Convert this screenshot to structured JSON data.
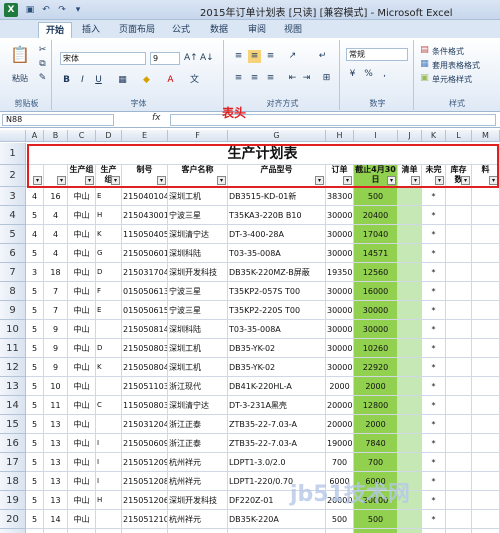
{
  "window": {
    "title": "2015年订单计划表 [只读] [兼容模式] - Microsoft Excel",
    "logo": "X"
  },
  "quick_access": [
    "save-icon",
    "undo-icon",
    "redo-icon",
    "dropdown-icon"
  ],
  "tabs": [
    "开始",
    "插入",
    "页面布局",
    "公式",
    "数据",
    "审阅",
    "视图"
  ],
  "ribbon": {
    "clipboard": {
      "paste": "粘贴",
      "label": "剪贴板"
    },
    "font": {
      "name": "宋体",
      "size": "9",
      "bold": "B",
      "italic": "I",
      "underline": "U",
      "label": "字体"
    },
    "align": {
      "label": "对齐方式"
    },
    "number": {
      "format": "常规",
      "percent": "%",
      "comma": ",",
      "label": "数字"
    },
    "styles": {
      "conditional": "条件格式",
      "table": "套用表格格式",
      "cell": "单元格样式",
      "label": "样式"
    }
  },
  "formula_bar": {
    "name_box": "N88",
    "fx": "fx",
    "value": ""
  },
  "columns": [
    "A",
    "B",
    "C",
    "D",
    "E",
    "F",
    "G",
    "H",
    "I",
    "J",
    "K",
    "L",
    "M"
  ],
  "sheet": {
    "title": "生产计划表",
    "header": [
      "",
      "",
      "生产组",
      "生产组",
      "制号",
      "客户名称",
      "产品型号",
      "订单",
      "截止4月30日",
      "清单",
      "未完",
      "库存数",
      "料"
    ],
    "rows": [
      {
        "n": "3",
        "a": "4",
        "b": "16",
        "c": "中山",
        "d": "E",
        "e": "215040104",
        "f": "深圳工机",
        "g": "DB3515-KD-01新",
        "h": "38300",
        "i": "500",
        "k": "*"
      },
      {
        "n": "4",
        "a": "5",
        "b": "4",
        "c": "中山",
        "d": "H",
        "e": "215043001",
        "f": "宁波三星",
        "g": "T35KA3-220B B10",
        "h": "30000",
        "i": "20400",
        "k": "*"
      },
      {
        "n": "5",
        "a": "4",
        "b": "4",
        "c": "中山",
        "d": "K",
        "e": "115050405",
        "f": "深圳清宁达",
        "g": "DT-3-400-28A",
        "h": "30000",
        "i": "17040",
        "k": "*"
      },
      {
        "n": "6",
        "a": "5",
        "b": "4",
        "c": "中山",
        "d": "G",
        "e": "215050601",
        "f": "深圳科陆",
        "g": "T03-35-008A",
        "h": "30000",
        "i": "14571",
        "k": "*"
      },
      {
        "n": "7",
        "a": "3",
        "b": "18",
        "c": "中山",
        "d": "D",
        "e": "215031704",
        "f": "深圳开发科技",
        "g": "DB35K-220MZ-B屏蔽",
        "h": "19350",
        "i": "12560",
        "k": "*"
      },
      {
        "n": "8",
        "a": "5",
        "b": "7",
        "c": "中山",
        "d": "F",
        "e": "015050613",
        "f": "宁波三星",
        "g": "T35KP2-057S T00",
        "h": "30000",
        "i": "16000",
        "k": "*"
      },
      {
        "n": "9",
        "a": "5",
        "b": "7",
        "c": "中山",
        "d": "E",
        "e": "015050615",
        "f": "宁波三星",
        "g": "T35KP2-220S T00",
        "h": "30000",
        "i": "30000",
        "k": "*"
      },
      {
        "n": "10",
        "a": "5",
        "b": "9",
        "c": "中山",
        "d": "",
        "e": "215050814",
        "f": "深圳科陆",
        "g": "T03-35-008A",
        "h": "30000",
        "i": "30000",
        "k": "*"
      },
      {
        "n": "11",
        "a": "5",
        "b": "9",
        "c": "中山",
        "d": "D",
        "e": "215050803",
        "f": "深圳工机",
        "g": "DB35-YK-02",
        "h": "30000",
        "i": "10260",
        "k": "*"
      },
      {
        "n": "12",
        "a": "5",
        "b": "9",
        "c": "中山",
        "d": "K",
        "e": "215050804",
        "f": "深圳工机",
        "g": "DB35-YK-02",
        "h": "30000",
        "i": "22920",
        "k": "*"
      },
      {
        "n": "13",
        "a": "5",
        "b": "10",
        "c": "中山",
        "d": "",
        "e": "215051103",
        "f": "浙江现代",
        "g": "DB41K-220HL-A",
        "h": "2000",
        "i": "2000",
        "k": "*"
      },
      {
        "n": "14",
        "a": "5",
        "b": "11",
        "c": "中山",
        "d": "C",
        "e": "115050803",
        "f": "深圳清宁达",
        "g": "DT-3-231A黑壳",
        "h": "20000",
        "i": "12800",
        "k": "*"
      },
      {
        "n": "15",
        "a": "5",
        "b": "13",
        "c": "中山",
        "d": "",
        "e": "215031204",
        "f": "浙江正泰",
        "g": "ZTB35-22-7.03-A",
        "h": "20000",
        "i": "2000",
        "k": "*"
      },
      {
        "n": "16",
        "a": "5",
        "b": "13",
        "c": "中山",
        "d": "I",
        "e": "215050609",
        "f": "浙江正泰",
        "g": "ZTB35-22-7.03-A",
        "h": "19000",
        "i": "7840",
        "k": "*"
      },
      {
        "n": "17",
        "a": "5",
        "b": "13",
        "c": "中山",
        "d": "I",
        "e": "215051209",
        "f": "杭州祥元",
        "g": "LDPT1-3.0/2.0",
        "h": "700",
        "i": "700",
        "k": "*"
      },
      {
        "n": "18",
        "a": "5",
        "b": "13",
        "c": "中山",
        "d": "I",
        "e": "215051208",
        "f": "杭州祥元",
        "g": "LDPT1-220/0.70",
        "h": "6000",
        "i": "6000",
        "k": "*"
      },
      {
        "n": "19",
        "a": "5",
        "b": "13",
        "c": "中山",
        "d": "H",
        "e": "215051206",
        "f": "深圳开发科技",
        "g": "DF220Z-01",
        "h": "20000",
        "i": "20000",
        "k": "*"
      },
      {
        "n": "20",
        "a": "5",
        "b": "14",
        "c": "中山",
        "d": "",
        "e": "215051210",
        "f": "杭州祥元",
        "g": "DB35K-220A",
        "h": "500",
        "i": "500",
        "k": "*"
      },
      {
        "n": "21",
        "a": "5",
        "b": "14",
        "c": "中山",
        "d": "",
        "e": "115051302",
        "f": "珠海一多",
        "g": "DB35K-220B",
        "h": "",
        "i": "",
        "k": "*"
      }
    ]
  },
  "annotation": "表头",
  "watermark": "jb51技术网"
}
